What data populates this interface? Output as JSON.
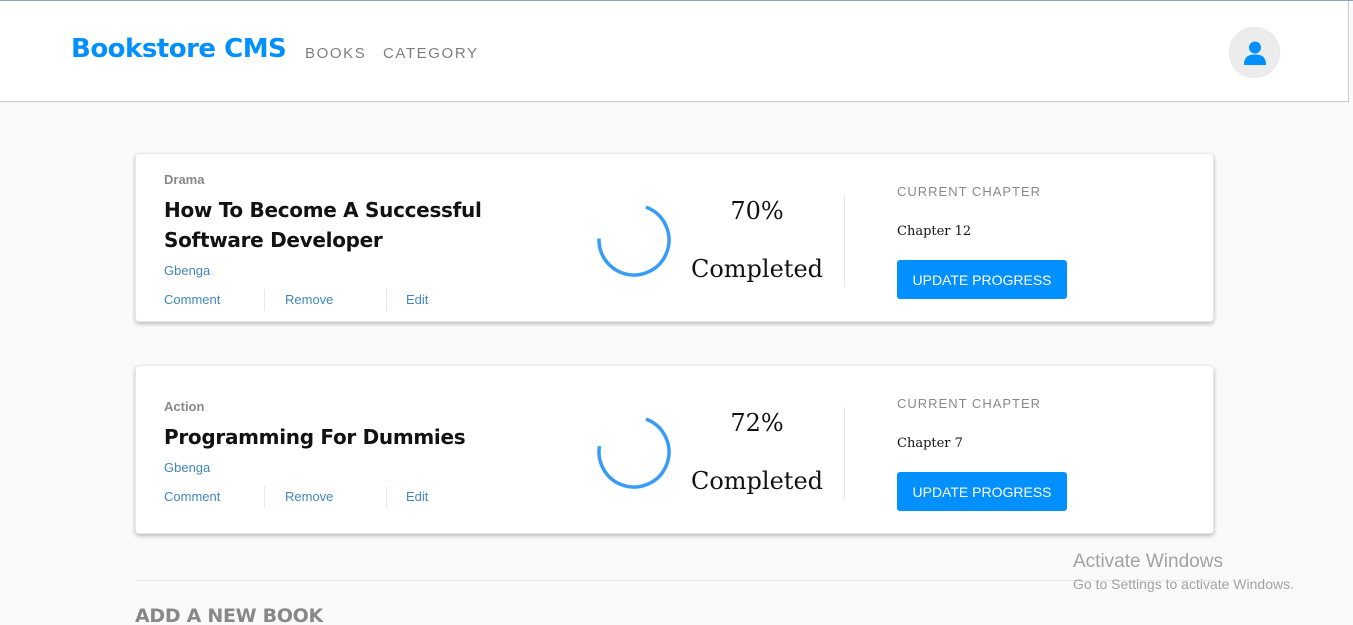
{
  "header": {
    "logo": "Bookstore CMS",
    "nav": [
      "BOOKS",
      "CATEGORY"
    ],
    "avatar_icon": "user-icon",
    "accent_color": "#0290ff"
  },
  "books": [
    {
      "genre": "Drama",
      "title": "How To Become A Successful Software Developer",
      "author": "Gbenga",
      "actions": [
        "Comment",
        "Remove",
        "Edit"
      ],
      "progress_percent": 70,
      "percent_label": "70%",
      "completed_label": "Completed",
      "current_chapter_label": "CURRENT CHAPTER",
      "current_chapter": "Chapter 12",
      "update_button": "UPDATE PROGRESS"
    },
    {
      "genre": "Action",
      "title": "Programming For Dummies",
      "author": "Gbenga",
      "actions": [
        "Comment",
        "Remove",
        "Edit"
      ],
      "progress_percent": 72,
      "percent_label": "72%",
      "completed_label": "Completed",
      "current_chapter_label": "CURRENT CHAPTER",
      "current_chapter": "Chapter 7",
      "update_button": "UPDATE PROGRESS"
    }
  ],
  "add_book": {
    "title": "ADD A NEW BOOK"
  },
  "watermark": {
    "title": "Activate Windows",
    "subtitle": "Go to Settings to activate Windows."
  }
}
